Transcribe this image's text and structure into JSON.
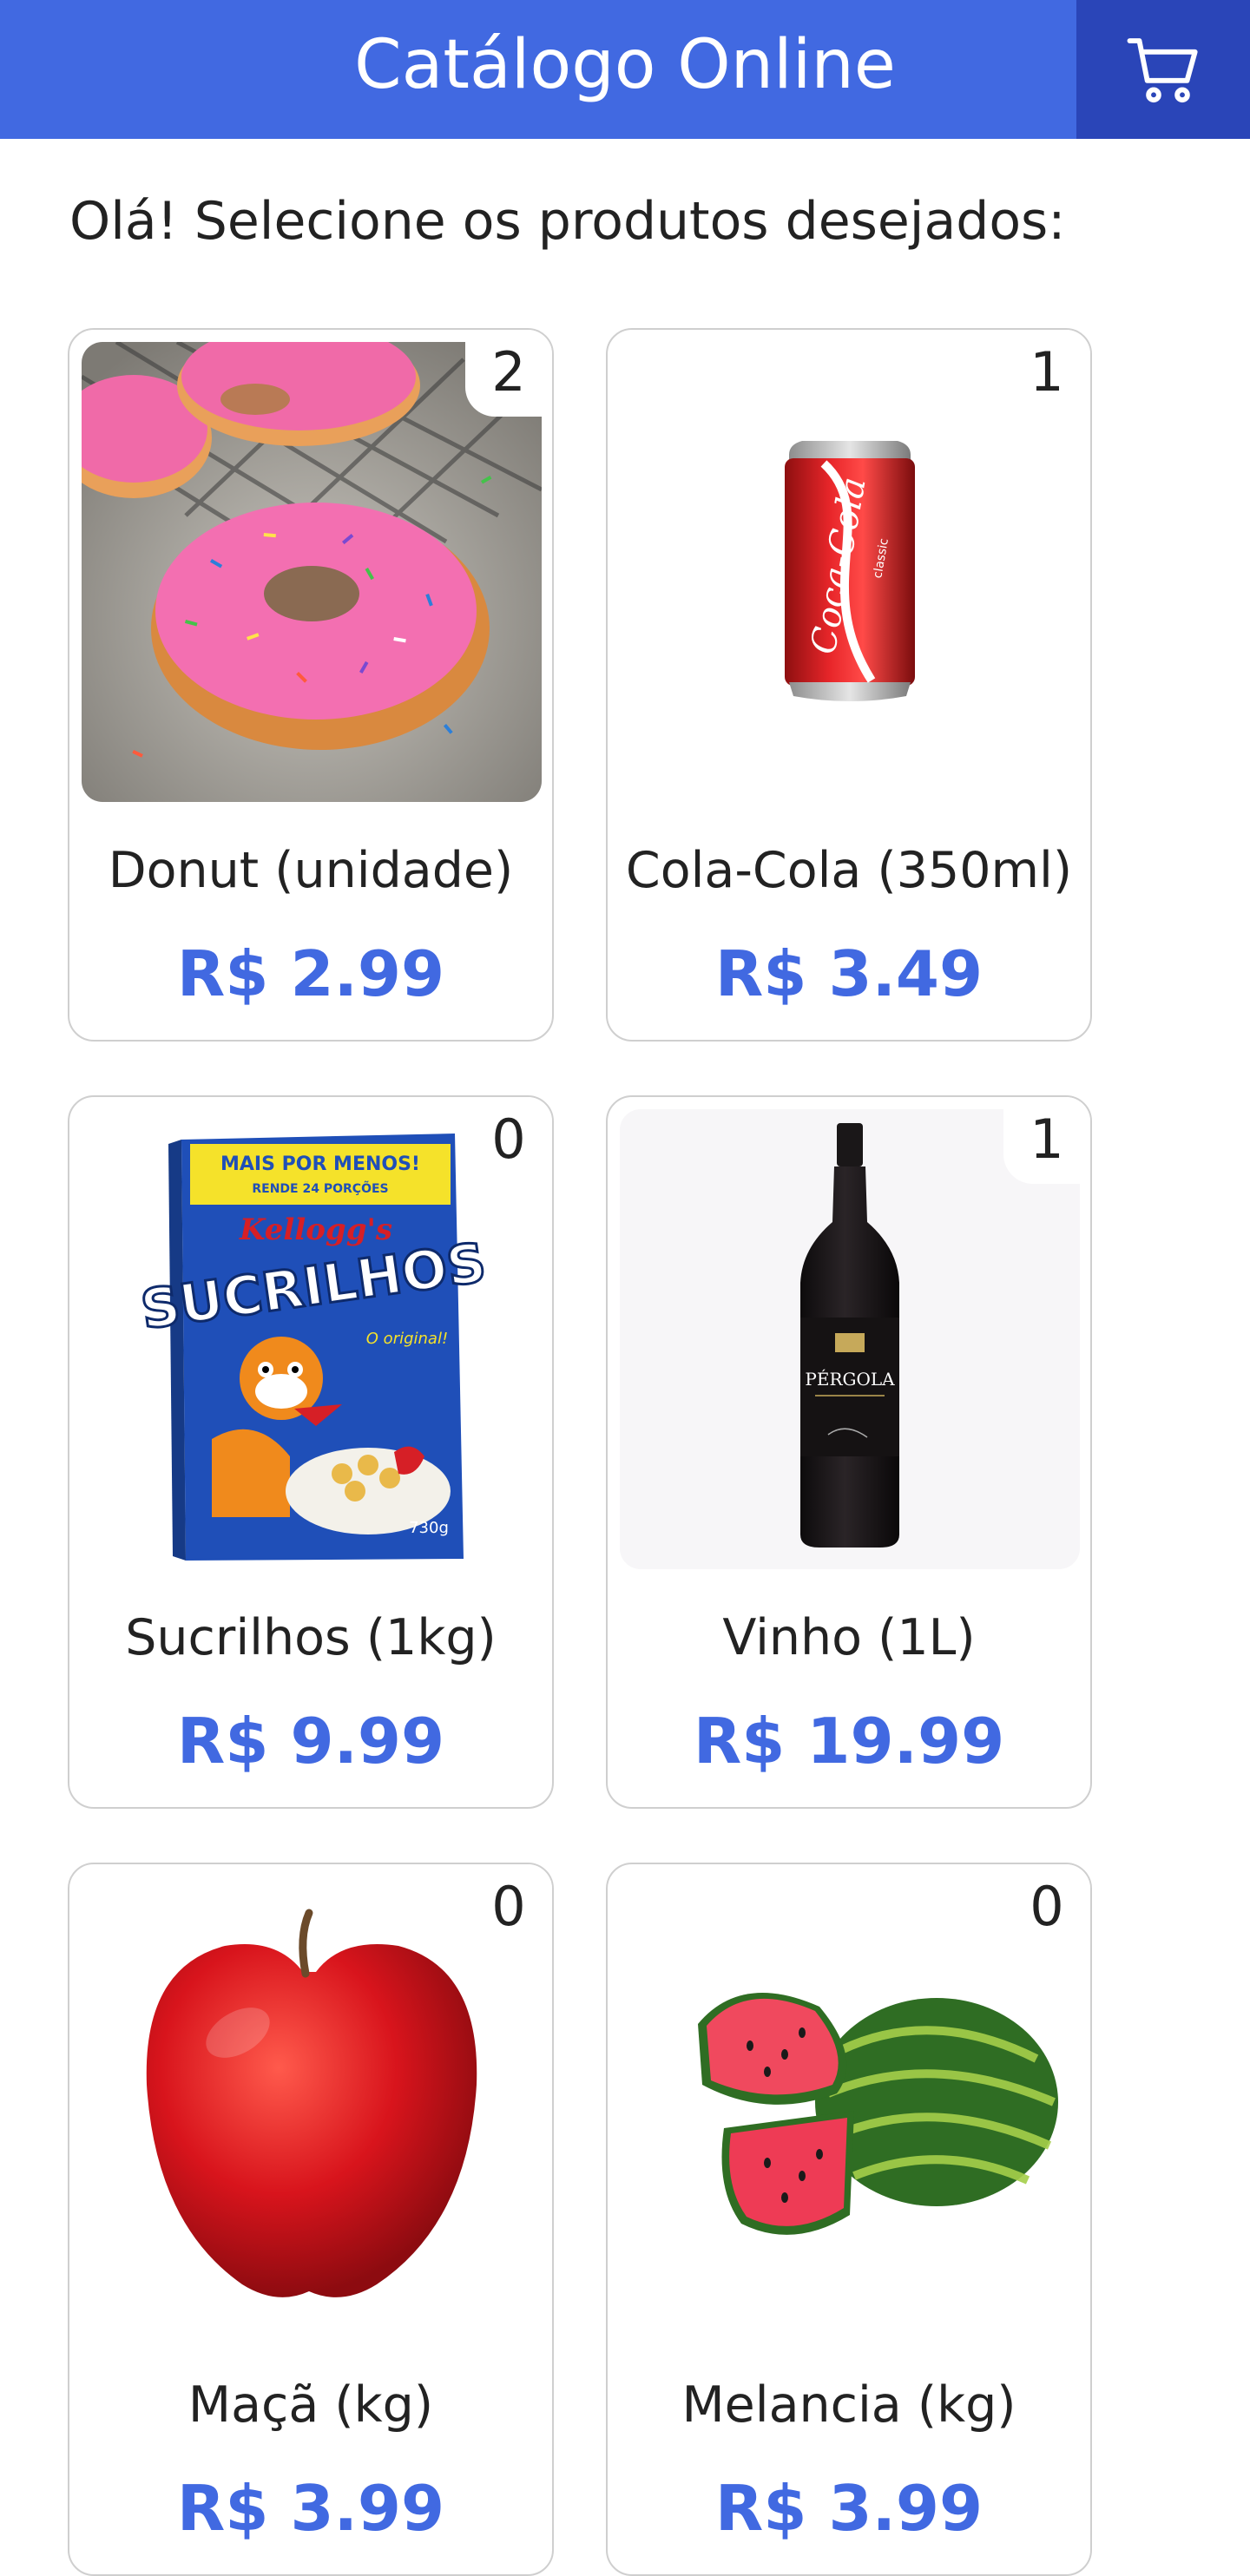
{
  "header": {
    "title": "Catálogo Online",
    "cart_icon": "cart-icon",
    "background": "#4169e1",
    "cart_background": "#2a45b8"
  },
  "greeting": "Olá! Selecione os produtos desejados:",
  "accent_color": "#4169e1",
  "products": [
    {
      "name": "Donut (unidade)",
      "price": "R$ 2.99",
      "count": "2",
      "image": "donut-image"
    },
    {
      "name": "Cola-Cola (350ml)",
      "price": "R$ 3.49",
      "count": "1",
      "image": "cola-can-image"
    },
    {
      "name": "Sucrilhos (1kg)",
      "price": "R$ 9.99",
      "count": "0",
      "image": "cereal-box-image"
    },
    {
      "name": "Vinho (1L)",
      "price": "R$ 19.99",
      "count": "1",
      "image": "wine-bottle-image"
    },
    {
      "name": "Maçã (kg)",
      "price": "R$ 3.99",
      "count": "0",
      "image": "apple-image"
    },
    {
      "name": "Melancia (kg)",
      "price": "R$ 3.99",
      "count": "0",
      "image": "watermelon-image"
    }
  ],
  "product_images": {
    "cereal_box": {
      "banner": "MAIS POR MENOS!",
      "banner_sub": "RENDE 24 PORÇÕES",
      "brand": "Kellogg's",
      "title": "SUCRILHOS",
      "tagline": "O original!",
      "weight": "730g"
    },
    "cola_can": {
      "brand": "Coca-Cola",
      "variant": "classic"
    },
    "wine_bottle": {
      "label": "PÉRGOLA"
    }
  }
}
